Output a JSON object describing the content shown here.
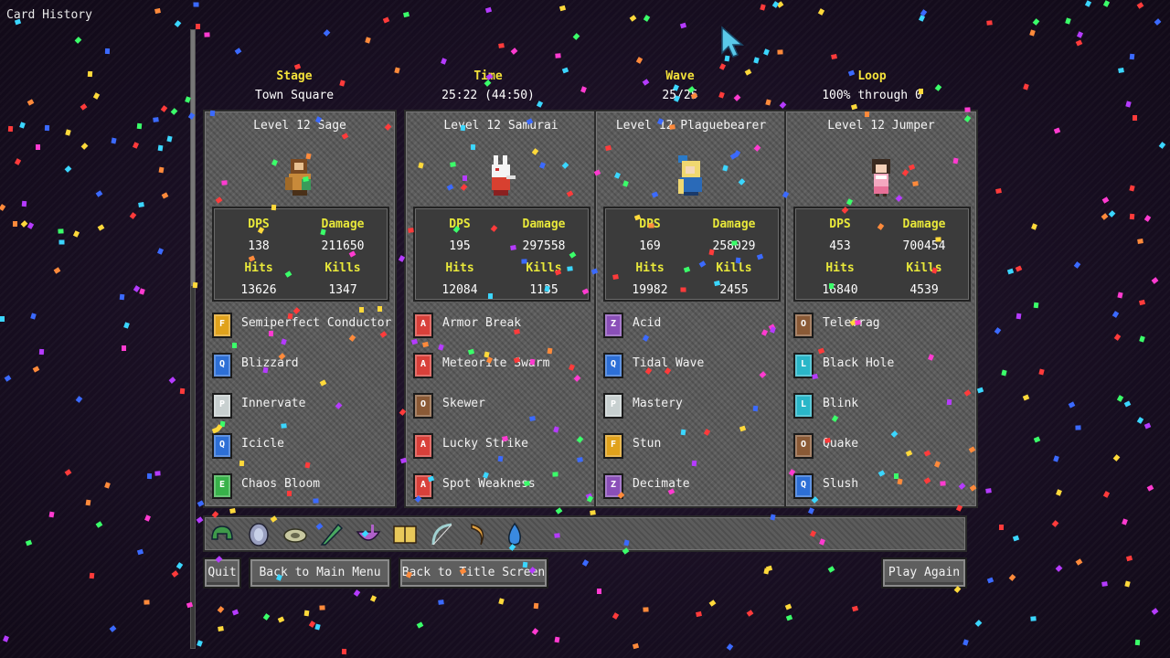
{
  "screen_title": "Card History",
  "summary": [
    {
      "label": "Stage",
      "value": "Town Square"
    },
    {
      "label": "Time",
      "value": "25:22 (44:50)"
    },
    {
      "label": "Wave",
      "value": "25/25"
    },
    {
      "label": "Loop",
      "value": "100% through 0"
    }
  ],
  "stat_labels": {
    "dps": "DPS",
    "damage": "Damage",
    "hits": "Hits",
    "kills": "Kills"
  },
  "characters": [
    {
      "title": "Level 12 Sage",
      "avatar": "sage-avatar",
      "stats": {
        "dps": "138",
        "damage": "211650",
        "hits": "13626",
        "kills": "1347"
      },
      "cards": [
        {
          "name": "Semiperfect Conductor",
          "glyph": "F",
          "color": "#e0a21c",
          "icon": "card-icon"
        },
        {
          "name": "Blizzard",
          "glyph": "Q",
          "color": "#2d6fd6",
          "icon": "card-icon"
        },
        {
          "name": "Innervate",
          "glyph": "P",
          "color": "#c8d0d0",
          "icon": "card-icon"
        },
        {
          "name": "Icicle",
          "glyph": "Q",
          "color": "#2d6fd6",
          "icon": "card-icon"
        },
        {
          "name": "Chaos Bloom",
          "glyph": "E",
          "color": "#38b24a",
          "icon": "card-icon"
        }
      ]
    },
    {
      "title": "Level 12 Samurai",
      "avatar": "samurai-avatar",
      "stats": {
        "dps": "195",
        "damage": "297558",
        "hits": "12084",
        "kills": "1135"
      },
      "cards": [
        {
          "name": "Armor Break",
          "glyph": "A",
          "color": "#d8403a",
          "icon": "card-icon"
        },
        {
          "name": "Meteorite Swarm",
          "glyph": "A",
          "color": "#d8403a",
          "icon": "card-icon"
        },
        {
          "name": "Skewer",
          "glyph": "O",
          "color": "#8a5a36",
          "icon": "card-icon"
        },
        {
          "name": "Lucky Strike",
          "glyph": "A",
          "color": "#d8403a",
          "icon": "card-icon"
        },
        {
          "name": "Spot Weakness",
          "glyph": "A",
          "color": "#d8403a",
          "icon": "card-icon"
        }
      ]
    },
    {
      "title": "Level 12 Plaguebearer",
      "avatar": "plaguebearer-avatar",
      "stats": {
        "dps": "169",
        "damage": "258029",
        "hits": "19982",
        "kills": "2455"
      },
      "cards": [
        {
          "name": "Acid",
          "glyph": "Z",
          "color": "#8a4fb8",
          "icon": "card-icon"
        },
        {
          "name": "Tidal Wave",
          "glyph": "Q",
          "color": "#2d6fd6",
          "icon": "card-icon"
        },
        {
          "name": "Mastery",
          "glyph": "P",
          "color": "#c8d0d0",
          "icon": "card-icon"
        },
        {
          "name": "Stun",
          "glyph": "F",
          "color": "#e0a21c",
          "icon": "card-icon"
        },
        {
          "name": "Decimate",
          "glyph": "Z",
          "color": "#8a4fb8",
          "icon": "card-icon"
        }
      ]
    },
    {
      "title": "Level 12 Jumper",
      "avatar": "jumper-avatar",
      "stats": {
        "dps": "453",
        "damage": "700454",
        "hits": "16840",
        "kills": "4539"
      },
      "cards": [
        {
          "name": "Telefrag",
          "glyph": "O",
          "color": "#8a5a36",
          "icon": "card-icon"
        },
        {
          "name": "Black Hole",
          "glyph": "L",
          "color": "#2ab6c8",
          "icon": "card-icon"
        },
        {
          "name": "Blink",
          "glyph": "L",
          "color": "#2ab6c8",
          "icon": "card-icon"
        },
        {
          "name": "Quake",
          "glyph": "O",
          "color": "#8a5a36",
          "icon": "card-icon"
        },
        {
          "name": "Slush",
          "glyph": "Q",
          "color": "#2d6fd6",
          "icon": "card-icon"
        }
      ]
    }
  ],
  "relics": [
    {
      "icon": "green-helmet-icon",
      "color": "#3f9a4a"
    },
    {
      "icon": "round-shield-icon",
      "color": "#9aa0c0"
    },
    {
      "icon": "seed-pod-icon",
      "color": "#c8c8a0"
    },
    {
      "icon": "green-blade-icon",
      "color": "#4aa860"
    },
    {
      "icon": "purple-bowl-icon",
      "color": "#b060c8"
    },
    {
      "icon": "open-book-icon",
      "color": "#e8c85a"
    },
    {
      "icon": "bow-icon",
      "color": "#a0d0d0"
    },
    {
      "icon": "crescent-horn-icon",
      "color": "#e0a040"
    },
    {
      "icon": "blue-flame-icon",
      "color": "#3a8ae0"
    }
  ],
  "buttons": {
    "quit": "Quit",
    "main_menu": "Back to Main Menu",
    "title_screen": "Back to Title Screen",
    "play_again": "Play Again"
  },
  "confetti_colors": [
    "#ff3b3b",
    "#ffd93b",
    "#3bff6a",
    "#3bd6ff",
    "#b53bff",
    "#ff8a3b",
    "#3b6aff",
    "#ff3bd0"
  ]
}
